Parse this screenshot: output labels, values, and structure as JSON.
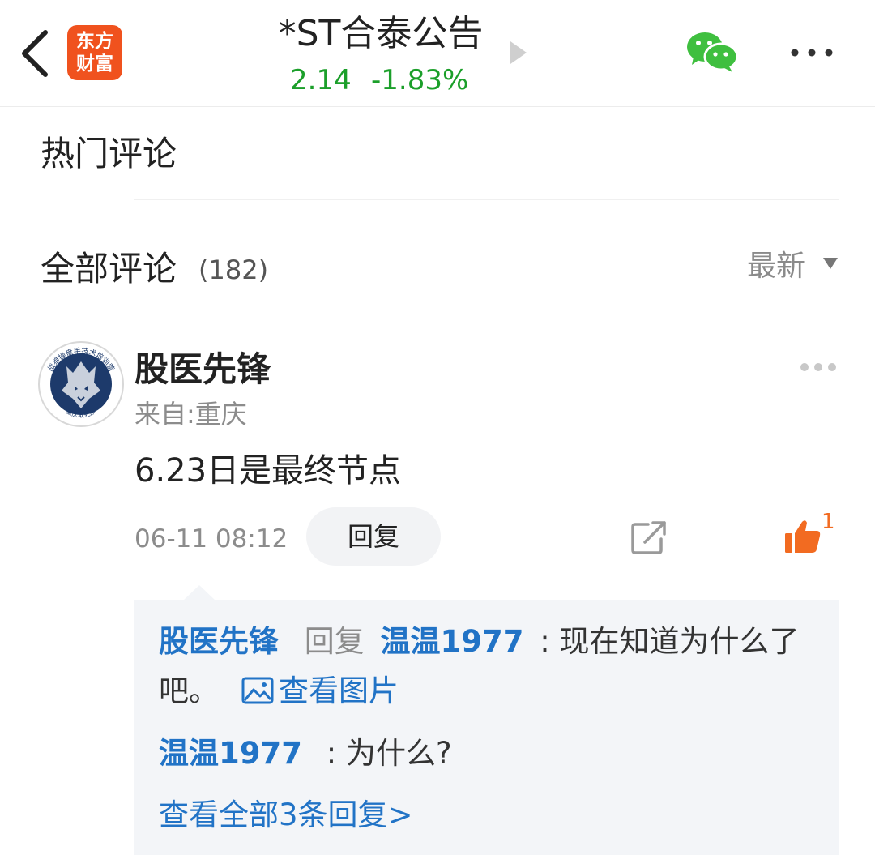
{
  "header": {
    "logo_line1": "东方",
    "logo_line2": "财富",
    "title": "*ST合泰公告",
    "price": "2.14",
    "change": "-1.83%",
    "price_color": "#1b9f2a",
    "logo_color": "#f0521e"
  },
  "hot_section": {
    "title": "热门评论"
  },
  "all_section": {
    "title": "全部评论",
    "count": "(182)",
    "sort_label": "最新"
  },
  "comment": {
    "avatar_top_text": "战狼操盘手技术培训营",
    "avatar_bottom_text": "重庆敢死队",
    "author": "股医先锋",
    "location": "来自:重庆",
    "text": "6.23日是最终节点",
    "time": "06-11 08:12",
    "reply_label": "回复",
    "like_count": "1",
    "like_color": "#f26b21"
  },
  "replies": {
    "reply1": {
      "author": "股医先锋",
      "reply_word": "回复",
      "target": "温温1977",
      "colon": ":",
      "text_line1": "现在知道为什么了",
      "text_line2": "吧。",
      "view_image": "查看图片"
    },
    "reply2": {
      "author": "温温1977",
      "colon": ":",
      "text": "为什么?"
    },
    "view_all": "查看全部3条回复>",
    "link_color": "#2173c6"
  }
}
